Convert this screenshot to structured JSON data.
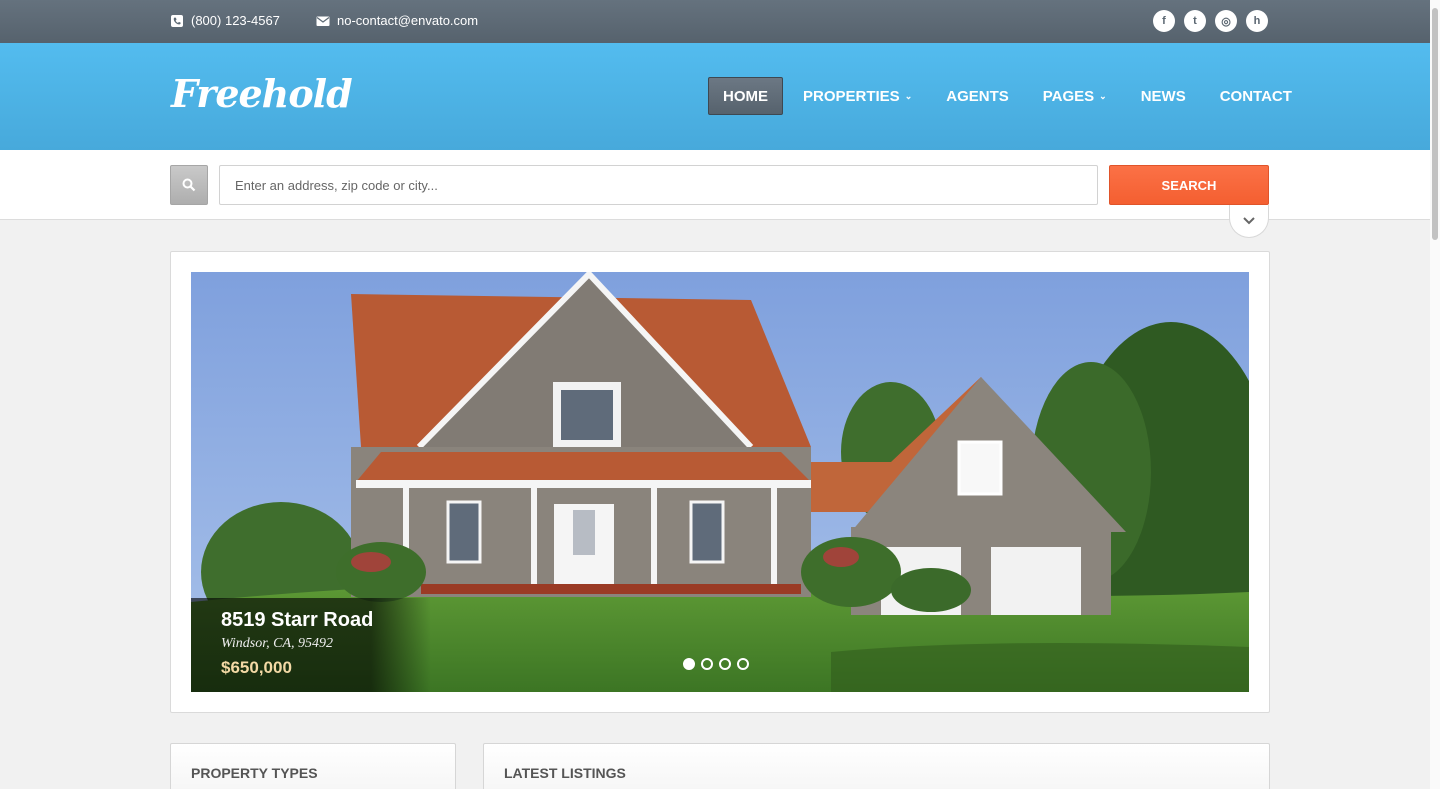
{
  "topbar": {
    "phone": "(800) 123-4567",
    "email": "no-contact@envato.com",
    "socials": [
      {
        "name": "facebook",
        "glyph": "f"
      },
      {
        "name": "twitter",
        "glyph": "t"
      },
      {
        "name": "instagram",
        "glyph": "◎"
      },
      {
        "name": "houzz",
        "glyph": "h"
      }
    ]
  },
  "header": {
    "logo": "Freehold",
    "nav": [
      {
        "label": "HOME",
        "active": true,
        "dropdown": false
      },
      {
        "label": "PROPERTIES",
        "active": false,
        "dropdown": true
      },
      {
        "label": "AGENTS",
        "active": false,
        "dropdown": false
      },
      {
        "label": "PAGES",
        "active": false,
        "dropdown": true
      },
      {
        "label": "NEWS",
        "active": false,
        "dropdown": false
      },
      {
        "label": "CONTACT",
        "active": false,
        "dropdown": false
      }
    ]
  },
  "search": {
    "placeholder": "Enter an address, zip code or city...",
    "button": "SEARCH"
  },
  "slider": {
    "title": "8519 Starr Road",
    "location": "Windsor, CA, 95492",
    "price": "$650,000",
    "slide_count": 4,
    "active_index": 0
  },
  "widgets": {
    "property_types": "PROPERTY TYPES",
    "latest_listings": "LATEST LISTINGS"
  },
  "colors": {
    "topbar": "#5d6a75",
    "header": "#4eb5e8",
    "search_button": "#f76638"
  }
}
